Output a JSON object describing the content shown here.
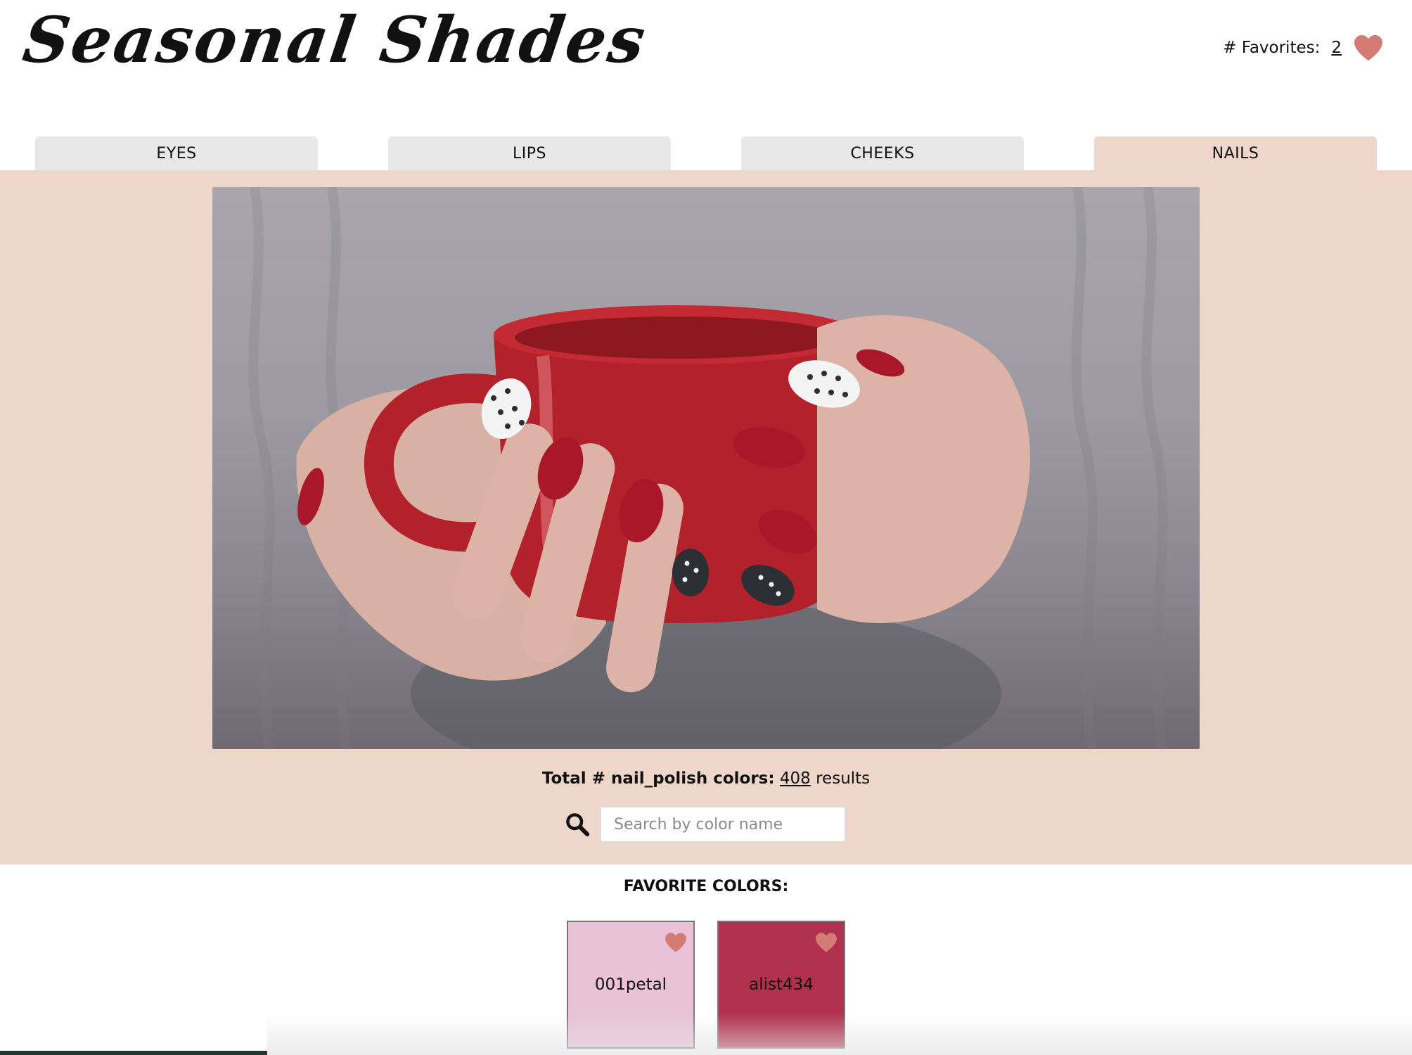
{
  "header": {
    "logo": "Seasonal Shades",
    "favorites_label": "# Favorites:",
    "favorites_count": "2"
  },
  "tabs": [
    {
      "label": "EYES",
      "active": false
    },
    {
      "label": "LIPS",
      "active": false
    },
    {
      "label": "CHEEKS",
      "active": false
    },
    {
      "label": "NAILS",
      "active": true
    }
  ],
  "main": {
    "hero_alt": "Hands with red and polka-dot nails holding a red mug",
    "total_label": "Total # nail_polish colors:",
    "total_count": "408",
    "total_suffix": "results",
    "search_placeholder": "Search by color name"
  },
  "favorites": {
    "title": "FAVORITE COLORS:",
    "items": [
      {
        "name": "001petal",
        "color": "#e9c2d7"
      },
      {
        "name": "alist434",
        "color": "#b0304d"
      }
    ]
  },
  "colors": {
    "heart": "#d47c74",
    "panel_bg": "#eed7ca",
    "tab_bg": "#e8e8e8"
  }
}
